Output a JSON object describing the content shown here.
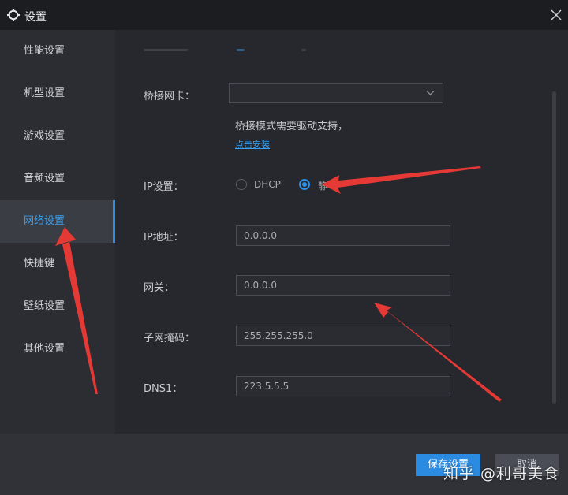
{
  "window": {
    "title": "设置",
    "icon": "gear-icon",
    "close_icon": "close-icon"
  },
  "sidebar": {
    "items": [
      {
        "label": "性能设置",
        "active": false
      },
      {
        "label": "机型设置",
        "active": false
      },
      {
        "label": "游戏设置",
        "active": false
      },
      {
        "label": "音频设置",
        "active": false
      },
      {
        "label": "网络设置",
        "active": true
      },
      {
        "label": "快捷键",
        "active": false
      },
      {
        "label": "壁纸设置",
        "active": false
      },
      {
        "label": "其他设置",
        "active": false
      }
    ]
  },
  "network": {
    "bridge_card": {
      "label": "桥接网卡：",
      "value": ""
    },
    "bridge_hint": "桥接模式需要驱动支持，",
    "install_link": "点击安装",
    "ip_setting": {
      "label": "IP设置：",
      "options": [
        {
          "label": "DHCP",
          "checked": false
        },
        {
          "label": "静",
          "checked": true
        }
      ]
    },
    "ip_address": {
      "label": "IP地址：",
      "value": "0.0.0.0"
    },
    "gateway": {
      "label": "网关：",
      "value": "0.0.0.0"
    },
    "subnet_mask": {
      "label": "子网掩码：",
      "value": "255.255.255.0"
    },
    "dns1": {
      "label": "DNS1：",
      "value": "223.5.5.5"
    }
  },
  "footer": {
    "save_label": "保存设置",
    "cancel_label": "取消"
  },
  "watermark": "知乎 @利哥美食",
  "colors": {
    "accent": "#2e8fe6",
    "link": "#3aa0f0",
    "annotation_arrow": "#e53935",
    "background": "#26282d",
    "sidebar": "#2b2d33",
    "titlebar": "#1c1d21"
  }
}
